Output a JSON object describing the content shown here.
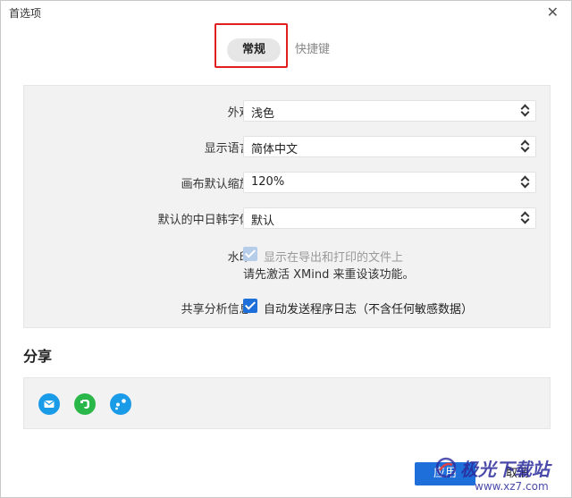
{
  "window": {
    "title": "首选项",
    "close_glyph": "✕"
  },
  "tabs": [
    {
      "label": "常规",
      "active": true
    },
    {
      "label": "快捷键",
      "active": false
    }
  ],
  "general": {
    "appearance": {
      "label": "外观:",
      "value": "浅色"
    },
    "language": {
      "label": "显示语言:",
      "value": "简体中文"
    },
    "zoom": {
      "label": "画布默认缩放:",
      "value": "120%"
    },
    "cjk_font": {
      "label": "默认的中日韩字体:",
      "value": "默认"
    },
    "watermark": {
      "label": "水印:",
      "checkbox_label": "显示在导出和打印的文件上",
      "checked": true,
      "disabled": true,
      "note": "请先激活 XMind 来重设该功能。"
    },
    "analytics": {
      "label": "共享分析信息:",
      "checkbox_label": "自动发送程序日志（不含任何敏感数据）",
      "checked": true
    }
  },
  "share": {
    "title": "分享",
    "icons": [
      "mail-icon",
      "evernote-icon",
      "share-link-icon"
    ]
  },
  "buttons": {
    "apply": "应用",
    "cancel": "取消"
  },
  "overlay_watermark": {
    "text": "极光下载站",
    "url": "www.xz7.com"
  },
  "colors": {
    "accent": "#1e6fd9",
    "highlight_box": "#e02020",
    "share_icon": "#1a9be8"
  }
}
